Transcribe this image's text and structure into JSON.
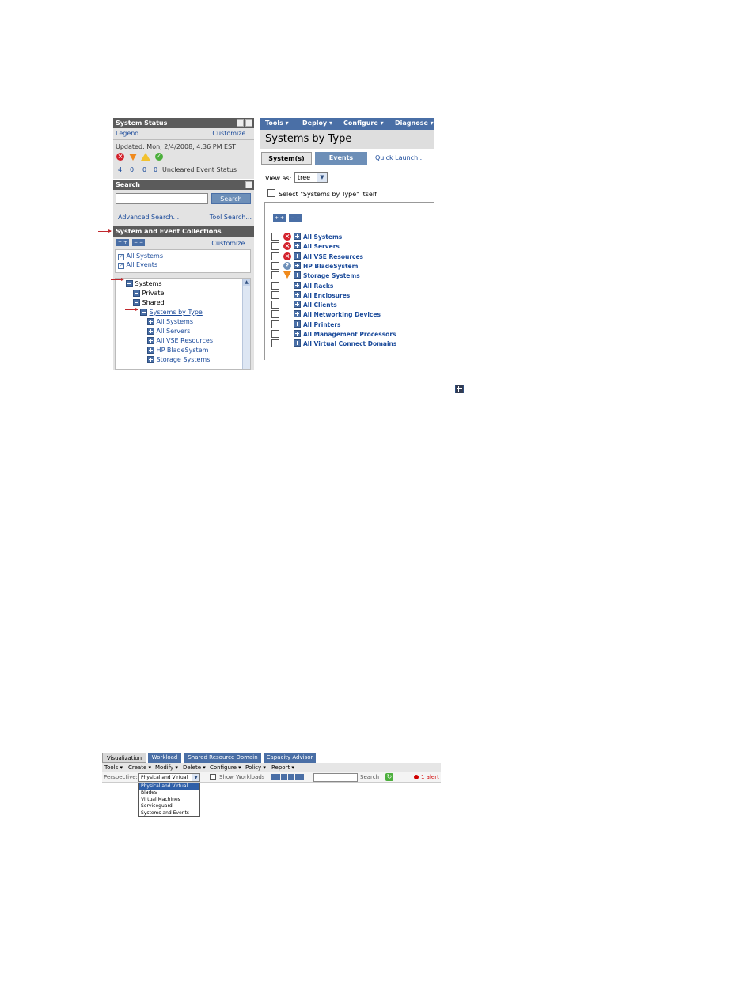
{
  "status": {
    "title": "System Status",
    "legend": "Legend...",
    "customize": "Customize...",
    "updated": "Updated: Mon, 2/4/2008, 4:36 PM EST",
    "counts": [
      "4",
      "0",
      "0",
      "0"
    ],
    "uncleared": "Uncleared Event Status"
  },
  "search": {
    "title": "Search",
    "button": "Search",
    "advanced": "Advanced Search...",
    "tool": "Tool Search..."
  },
  "collections": {
    "title": "System and Event Collections",
    "expand_all": "+ +",
    "collapse_all": "− −",
    "customize": "Customize...",
    "links": [
      "All Systems",
      "All Events"
    ]
  },
  "tree": {
    "systems": "Systems",
    "private": "Private",
    "shared": "Shared",
    "by_type": "Systems by Type",
    "children": [
      "All Systems",
      "All Servers",
      "All VSE Resources",
      "HP BladeSystem",
      "Storage Systems"
    ]
  },
  "topmenu": [
    "Tools ▾",
    "Deploy ▾",
    "Configure ▾",
    "Diagnose ▾"
  ],
  "main": {
    "title": "Systems by Type",
    "tabs": [
      "System(s)",
      "Events",
      "Quick Launch..."
    ],
    "view_as_label": "View as:",
    "view_as_value": "tree",
    "select_label": "Select \"Systems by Type\" itself",
    "items": [
      {
        "label": "All Systems",
        "status": "critical"
      },
      {
        "label": "All Servers",
        "status": "critical"
      },
      {
        "label": "All VSE Resources",
        "status": "critical"
      },
      {
        "label": "HP BladeSystem",
        "status": "unknown"
      },
      {
        "label": "Storage Systems",
        "status": "major"
      },
      {
        "label": "All Racks",
        "status": ""
      },
      {
        "label": "All Enclosures",
        "status": ""
      },
      {
        "label": "All Clients",
        "status": ""
      },
      {
        "label": "All Networking Devices",
        "status": ""
      },
      {
        "label": "All Printers",
        "status": ""
      },
      {
        "label": "All Management Processors",
        "status": ""
      },
      {
        "label": "All Virtual Connect Domains",
        "status": ""
      }
    ]
  },
  "toolbar2": {
    "tabs": [
      "Visualization",
      "Workload",
      "Shared Resource Domain",
      "Capacity Advisor"
    ],
    "menu": [
      "Tools ▾",
      "Create ▾",
      "Modify ▾",
      "Delete ▾",
      "Configure ▾",
      "Policy ▾",
      "Report ▾"
    ],
    "perspective_label": "Perspective:",
    "perspective_value": "Physical and Virtual",
    "show_workloads": "Show Workloads",
    "search": "Search",
    "alert": "1 alert",
    "options": [
      "Physical and Virtual",
      "Blades",
      "Virtual Machines",
      "Serviceguard",
      "Systems and Events"
    ]
  },
  "colors": {
    "header": "#5b5b5b",
    "tab_blue": "#6d8fb8",
    "link": "#1a4a9a",
    "critical": "#d3202a",
    "major": "#f08a1c",
    "alert": "#d00000"
  }
}
